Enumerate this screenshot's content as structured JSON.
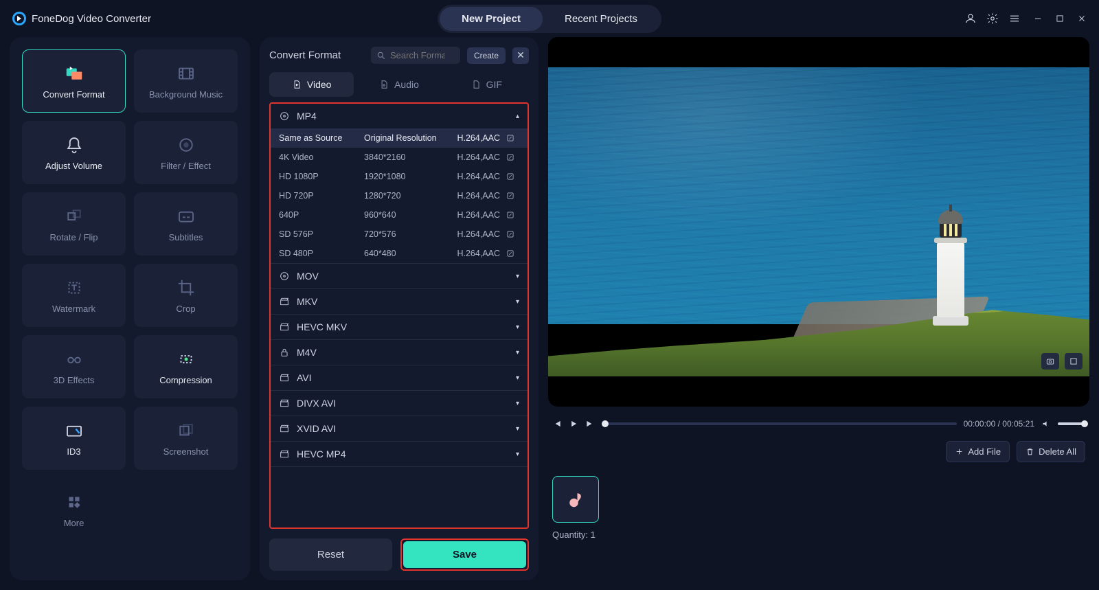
{
  "app_title": "FoneDog Video Converter",
  "top_tabs": {
    "new": "New Project",
    "recent": "Recent Projects"
  },
  "sidebar": {
    "tools": [
      {
        "id": "convert-format",
        "label": "Convert Format"
      },
      {
        "id": "background-music",
        "label": "Background Music"
      },
      {
        "id": "adjust-volume",
        "label": "Adjust Volume"
      },
      {
        "id": "filter-effect",
        "label": "Filter / Effect"
      },
      {
        "id": "rotate-flip",
        "label": "Rotate / Flip"
      },
      {
        "id": "subtitles",
        "label": "Subtitles"
      },
      {
        "id": "watermark",
        "label": "Watermark"
      },
      {
        "id": "crop",
        "label": "Crop"
      },
      {
        "id": "3d-effects",
        "label": "3D Effects"
      },
      {
        "id": "compression",
        "label": "Compression"
      },
      {
        "id": "id3",
        "label": "ID3"
      },
      {
        "id": "screenshot",
        "label": "Screenshot"
      },
      {
        "id": "more",
        "label": "More"
      }
    ]
  },
  "mid": {
    "title": "Convert Format",
    "search_placeholder": "Search Format",
    "create": "Create",
    "tabs": {
      "video": "Video",
      "audio": "Audio",
      "gif": "GIF"
    },
    "mp4_label": "MP4",
    "rows": [
      {
        "name": "Same as Source",
        "res": "Original Resolution",
        "codec": "H.264,AAC"
      },
      {
        "name": "4K Video",
        "res": "3840*2160",
        "codec": "H.264,AAC"
      },
      {
        "name": "HD 1080P",
        "res": "1920*1080",
        "codec": "H.264,AAC"
      },
      {
        "name": "HD 720P",
        "res": "1280*720",
        "codec": "H.264,AAC"
      },
      {
        "name": "640P",
        "res": "960*640",
        "codec": "H.264,AAC"
      },
      {
        "name": "SD 576P",
        "res": "720*576",
        "codec": "H.264,AAC"
      },
      {
        "name": "SD 480P",
        "res": "640*480",
        "codec": "H.264,AAC"
      }
    ],
    "groups": [
      "MOV",
      "MKV",
      "HEVC MKV",
      "M4V",
      "AVI",
      "DIVX AVI",
      "XVID AVI",
      "HEVC MP4"
    ],
    "reset": "Reset",
    "save": "Save"
  },
  "player": {
    "time": "00:00:00 / 00:05:21"
  },
  "filebar": {
    "add": "Add File",
    "del": "Delete All"
  },
  "clips": {
    "qty": "Quantity: 1"
  }
}
